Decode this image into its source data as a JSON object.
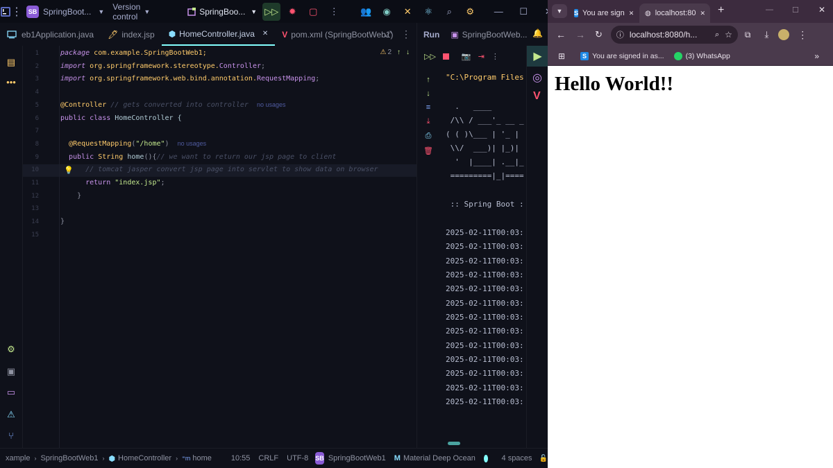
{
  "ide": {
    "project_badge": "SB",
    "project_name": "SpringBoot...",
    "vcs": "Version control",
    "run_config": "SpringBoo...",
    "tabs": [
      {
        "label": "eb1Application.java"
      },
      {
        "label": "index.jsp"
      },
      {
        "label": "HomeController.java"
      },
      {
        "label": "pom.xml (SpringBootWeb1)"
      }
    ],
    "run_panel_label": "Run",
    "run_tab_label": "SpringBootWeb...",
    "inspection_count": "2",
    "lines": [
      "1",
      "2",
      "3",
      "4",
      "5",
      "6",
      "7",
      "8",
      "9",
      "10",
      "11",
      "12",
      "13",
      "14",
      "15"
    ],
    "code": {
      "l1_kw": "package",
      "l1_rest": " com.example.SpringBootWeb1;",
      "l2_kw": "import",
      "l2_rest": " org.springframework.stereotype.",
      "l2_cls": "Controller",
      "l2_end": ";",
      "l3_kw": "import",
      "l3_rest": " org.springframework.web.bind.annotation.",
      "l3_cls": "RequestMapping",
      "l3_end": ";",
      "l5_ann": "@Controller",
      "l5_cm": " // gets converted into controller",
      "l5_hint": "no usages",
      "l6_kw": "public class",
      "l6_rest": " HomeController {",
      "l8_ann": "@RequestMapping",
      "l8_open": "(",
      "l8_str": "\"/home\"",
      "l8_close": ")",
      "l8_hint": "no usages",
      "l9_kw": "public",
      "l9_cls": " String",
      "l9_fn": " home",
      "l9_rest": "(){",
      "l9_cm": "// we want to return our jsp page to client",
      "l10_cm": "// tomcat jasper convert jsp page into servlet to show data on browser",
      "l11_kw": "return",
      "l11_str": " \"index.jsp\"",
      "l11_end": ";",
      "l12": "}",
      "l14": "}"
    },
    "console": {
      "cmd": "\"C:\\Program Files",
      "banner": [
        "  .   ____",
        " /\\\\ / ___'_ __ _",
        "( ( )\\___ | '_ |",
        " \\\\/  ___)| |_)|",
        "  '  |____| .__|_",
        " =========|_|===="
      ],
      "spring_boot": " :: Spring Boot :",
      "log_lines": [
        "2025-02-11T00:03:",
        "2025-02-11T00:03:",
        "2025-02-11T00:03:",
        "2025-02-11T00:03:",
        "2025-02-11T00:03:",
        "2025-02-11T00:03:",
        "2025-02-11T00:03:",
        "2025-02-11T00:03:",
        "2025-02-11T00:03:",
        "2025-02-11T00:03:",
        "2025-02-11T00:03:",
        "2025-02-11T00:03:",
        "2025-02-11T00:03:"
      ]
    },
    "status": {
      "crumb1": "xample",
      "crumb2": "SpringBootWeb1",
      "crumb3": "HomeController",
      "crumb4": "home",
      "position": "10:55",
      "line_sep": "CRLF",
      "encoding": "UTF-8",
      "module_badge": "SB",
      "module": "SpringBootWeb1",
      "theme": "Material Deep Ocean",
      "indent": "4 spaces"
    }
  },
  "browser": {
    "tabs": [
      {
        "label": "You are sign"
      },
      {
        "label": "localhost:80"
      }
    ],
    "url": "localhost:8080/h...",
    "bookmarks": [
      {
        "label": "You are signed in as..."
      },
      {
        "label": "(3) WhatsApp"
      }
    ],
    "page_heading": "Hello World!!"
  },
  "colors": {
    "accent": "#84ffff",
    "keyword": "#c792ea",
    "annotation": "#ffcb6b",
    "string": "#c3e88d",
    "badge": "#8a5bd6",
    "run_green": "#c3e88d",
    "stop_red": "#ff5370"
  }
}
